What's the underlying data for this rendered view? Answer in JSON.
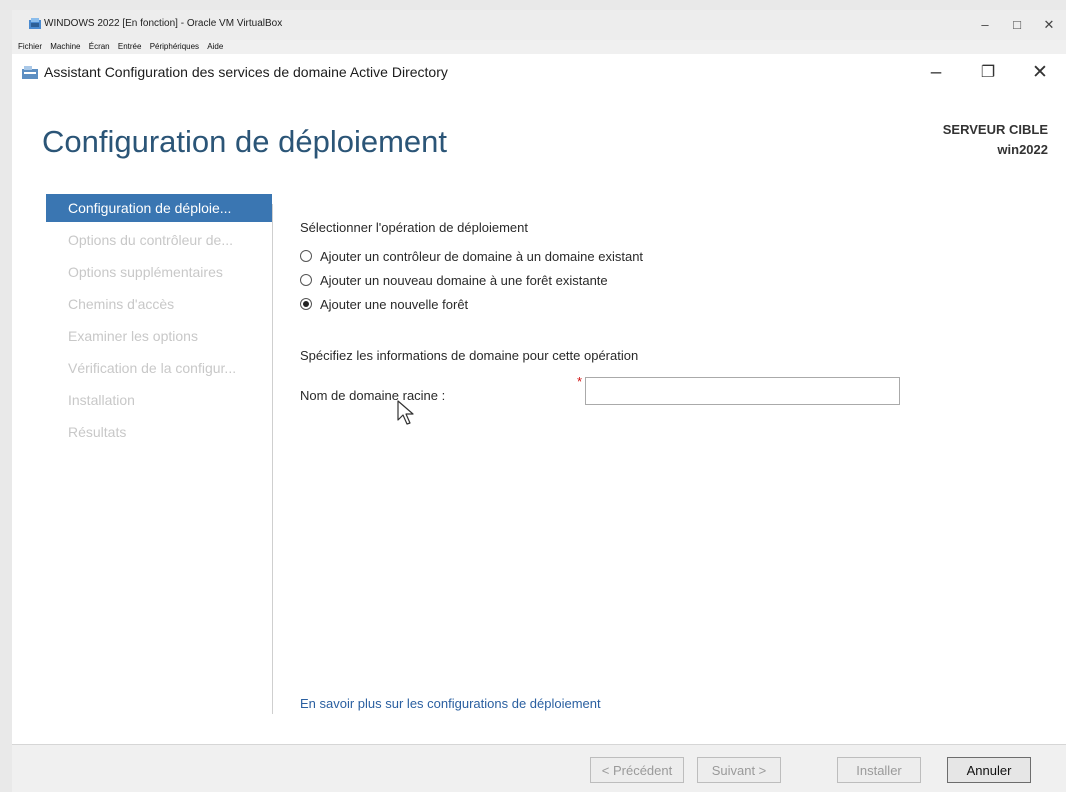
{
  "vbox": {
    "title": "WINDOWS 2022 [En fonction] - Oracle VM VirtualBox",
    "menu": [
      "Fichier",
      "Machine",
      "Écran",
      "Entrée",
      "Périphériques",
      "Aide"
    ],
    "controls": [
      "–",
      "□",
      "✕"
    ]
  },
  "wizard": {
    "title": "Assistant Configuration des services de domaine Active Directory",
    "controls": [
      "–",
      "❐",
      "✕"
    ],
    "heading": "Configuration de déploiement",
    "target_label": "SERVEUR CIBLE",
    "target_name": "win2022"
  },
  "nav": {
    "items": [
      {
        "label": "Configuration de déploie...",
        "active": true
      },
      {
        "label": "Options du contrôleur de...",
        "active": false
      },
      {
        "label": "Options supplémentaires",
        "active": false
      },
      {
        "label": "Chemins d'accès",
        "active": false
      },
      {
        "label": "Examiner les options",
        "active": false
      },
      {
        "label": "Vérification de la configur...",
        "active": false
      },
      {
        "label": "Installation",
        "active": false
      },
      {
        "label": "Résultats",
        "active": false
      }
    ]
  },
  "content": {
    "operation_label": "Sélectionner l'opération de déploiement",
    "options": [
      {
        "label": "Ajouter un contrôleur de domaine à un domaine existant",
        "checked": false
      },
      {
        "label": "Ajouter un nouveau domaine à une forêt existante",
        "checked": false
      },
      {
        "label": "Ajouter une nouvelle forêt",
        "checked": true
      }
    ],
    "domain_info_label": "Spécifiez les informations de domaine pour cette opération",
    "root_domain_label": "Nom de domaine racine :",
    "required_mark": "*",
    "root_domain_value": "",
    "learn_more": "En savoir plus sur les configurations de déploiement"
  },
  "buttons": {
    "previous": "< Précédent",
    "next": "Suivant >",
    "install": "Installer",
    "cancel": "Annuler"
  },
  "colors": {
    "accent": "#3a76b2",
    "heading": "#2b5577",
    "link": "#2a5fa0",
    "required": "#d01010"
  }
}
